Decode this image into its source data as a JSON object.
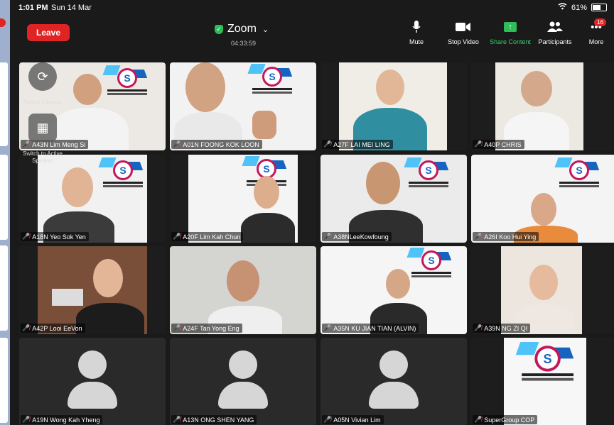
{
  "status_bar": {
    "time": "1:01 PM",
    "date": "Sun 14 Mar",
    "battery": "61%"
  },
  "toolbar": {
    "leave_label": "Leave",
    "meeting_title": "Zoom",
    "duration": "04:33:59",
    "mute_label": "Mute",
    "stop_video_label": "Stop Video",
    "share_label": "Share Content",
    "participants_label": "Participants",
    "more_label": "More",
    "more_badge": "16"
  },
  "overlays": {
    "switch_camera_label": "Switch Camera",
    "switch_speaker_label": "Switch to Active Speaker"
  },
  "participants": [
    {
      "name": "A43N  Lim Meng Si",
      "icon": "person-video"
    },
    {
      "name": "A01N FOONG KOK LOON",
      "icon": "person-video"
    },
    {
      "name": "A27F LAI MEI LING",
      "icon": "person-video"
    },
    {
      "name": "A40P CHRIS",
      "icon": "person-video"
    },
    {
      "name": "A18N Yeo Sok Yen",
      "icon": "person-video"
    },
    {
      "name": "A20F Lim Kah Chun",
      "icon": "person-video"
    },
    {
      "name": "A38NLeeKowfoung",
      "icon": "person-video"
    },
    {
      "name": "A26I Koo Hui Ying",
      "icon": "person-video"
    },
    {
      "name": "A42P Looi EeVon",
      "icon": "person-video"
    },
    {
      "name": "A24F Tan Yong Eng",
      "icon": "person-video"
    },
    {
      "name": "A35N KU JIAN TIAN (ALVIN)",
      "icon": "person-video"
    },
    {
      "name": "A39N NG ZI QI",
      "icon": "person-video"
    },
    {
      "name": "A19N Wong Kah Yheng",
      "icon": "avatar-placeholder"
    },
    {
      "name": "A13N  ONG SHEN YANG",
      "icon": "avatar-placeholder"
    },
    {
      "name": "A05N Vivian Lim",
      "icon": "avatar-placeholder"
    },
    {
      "name": "SuperGroup COP",
      "icon": "program-banner"
    }
  ],
  "colors": {
    "leave": "#e02424",
    "share": "#2ebd59",
    "mic_off": "#ff4b4b"
  }
}
